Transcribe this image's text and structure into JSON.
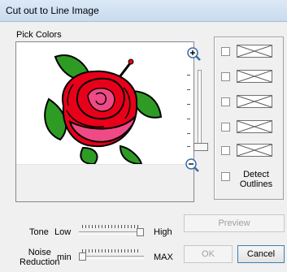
{
  "window": {
    "title": "Cut out to Line Image"
  },
  "pick_colors": {
    "label": "Pick Colors"
  },
  "options": {
    "detect_outlines": "Detect Outlines",
    "detect_line1": "Detect",
    "detect_line2": "Outlines"
  },
  "tone": {
    "label": "Tone",
    "min_label": "Low",
    "max_label": "High",
    "value": 1.0
  },
  "noise": {
    "label_line1": "Noise",
    "label_line2": "Reduction",
    "min_label": "min",
    "max_label": "MAX",
    "value": 0.0
  },
  "buttons": {
    "preview": "Preview",
    "ok": "OK",
    "cancel": "Cancel"
  },
  "colors": {
    "rose_red": "#e8001a",
    "rose_pink": "#f04a86",
    "leaf_green": "#2e9b25",
    "outline": "#000000"
  },
  "icons": {
    "zoom_in": "zoom-in-icon",
    "zoom_out": "zoom-out-icon"
  }
}
